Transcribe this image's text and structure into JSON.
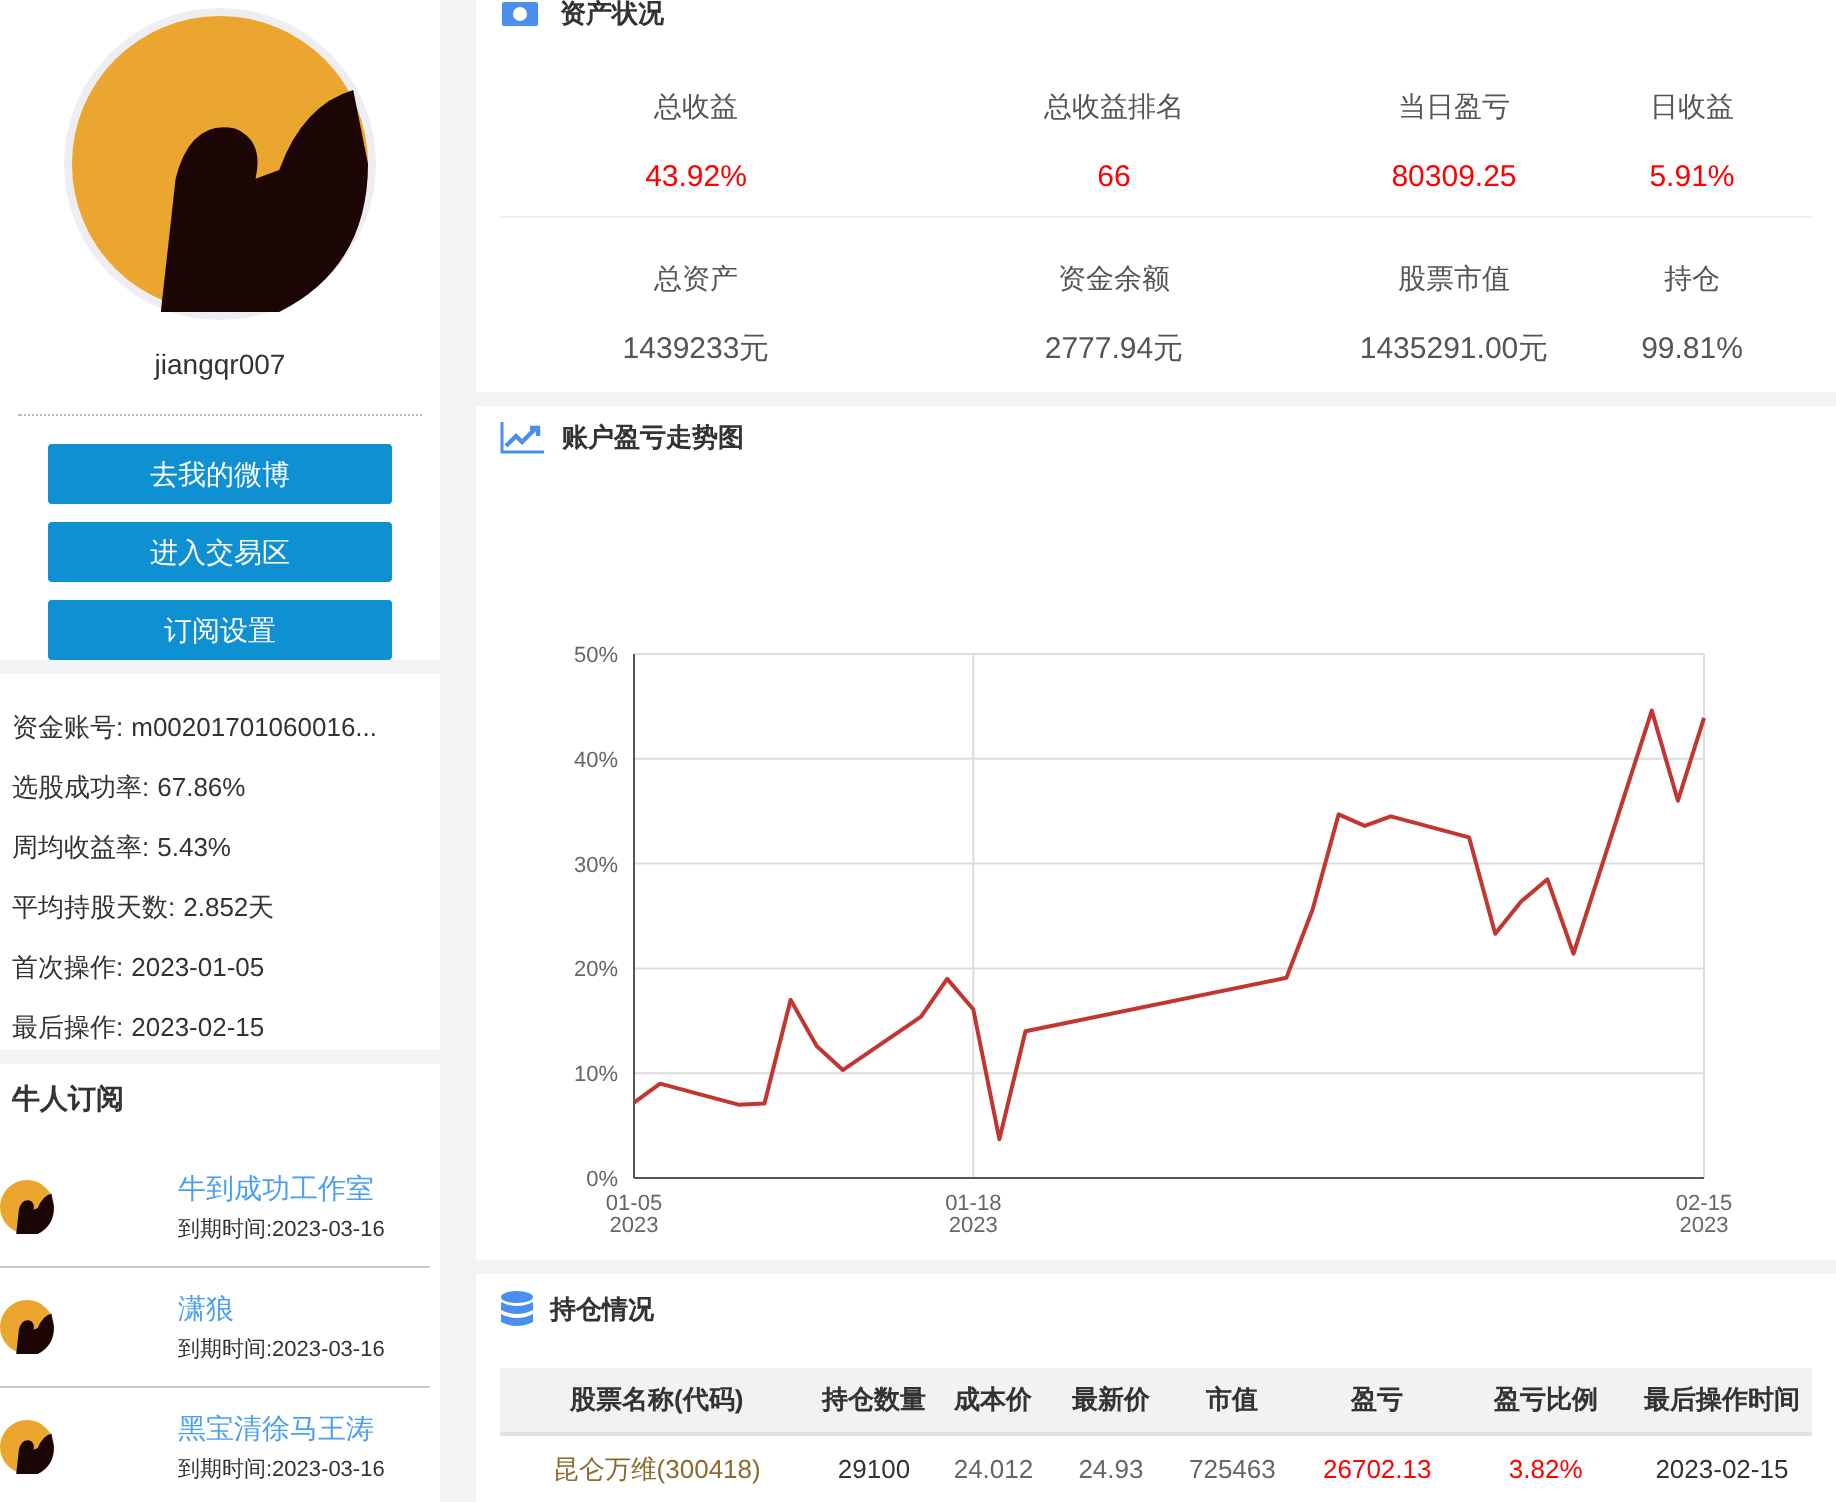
{
  "profile": {
    "username": "jiangqr007",
    "buttons": [
      "去我的微博",
      "进入交易区",
      "订阅设置"
    ]
  },
  "stats": [
    {
      "label": "资金账号:",
      "value": "m00201701060016..."
    },
    {
      "label": "选股成功率:",
      "value": "67.86%"
    },
    {
      "label": "周均收益率:",
      "value": "5.43%"
    },
    {
      "label": "平均持股天数:",
      "value": "2.852天"
    },
    {
      "label": "首次操作:",
      "value": "2023-01-05"
    },
    {
      "label": "最后操作:",
      "value": "2023-02-15"
    }
  ],
  "subscriptions": {
    "title": "牛人订阅",
    "items": [
      {
        "name": "牛到成功工作室",
        "expiry": "到期时间:2023-03-16"
      },
      {
        "name": "潇狼",
        "expiry": "到期时间:2023-03-16"
      },
      {
        "name": "黑宝清徐马王涛",
        "expiry": "到期时间:2023-03-16"
      }
    ]
  },
  "assets": {
    "title": "资产状况",
    "rows": [
      [
        {
          "label": "总收益",
          "value": "43.92%",
          "highlight": true
        },
        {
          "label": "总收益排名",
          "value": "66",
          "highlight": true
        },
        {
          "label": "当日盈亏",
          "value": "80309.25",
          "highlight": true
        },
        {
          "label": "日收益",
          "value": "5.91%",
          "highlight": true
        }
      ],
      [
        {
          "label": "总资产",
          "value": "1439233元",
          "highlight": false
        },
        {
          "label": "资金余额",
          "value": "2777.94元",
          "highlight": false
        },
        {
          "label": "股票市值",
          "value": "1435291.00元",
          "highlight": false
        },
        {
          "label": "持仓",
          "value": "99.81%",
          "highlight": false
        }
      ]
    ]
  },
  "trend": {
    "title": "账户盈亏走势图",
    "chart_data": {
      "type": "line",
      "categories": [
        "01-05 2023",
        null,
        null,
        null,
        null,
        null,
        null,
        null,
        null,
        null,
        null,
        null,
        null,
        "01-18 2023",
        null,
        null,
        null,
        null,
        null,
        null,
        null,
        null,
        null,
        null,
        null,
        null,
        null,
        null,
        null,
        null,
        null,
        null,
        null,
        null,
        null,
        null,
        null,
        null,
        null,
        null,
        null,
        "02-15 2023"
      ],
      "series": [
        {
          "color": "#c23531",
          "values": [
            7.2,
            9.0,
            null,
            null,
            7.0,
            7.1,
            17.0,
            12.6,
            10.3,
            null,
            null,
            15.4,
            19.0,
            16.1,
            3.7,
            14.0,
            null,
            null,
            null,
            null,
            null,
            null,
            null,
            null,
            null,
            19.1,
            25.6,
            34.7,
            33.6,
            34.5,
            null,
            null,
            32.5,
            23.3,
            26.4,
            28.5,
            21.4,
            null,
            null,
            44.6,
            36.0,
            43.9
          ]
        }
      ],
      "ylim": [
        0,
        50
      ],
      "grid": true,
      "yticks": [
        {
          "value": 0,
          "label": "0%"
        },
        {
          "value": 10,
          "label": "10%"
        },
        {
          "value": 20,
          "label": "20%"
        },
        {
          "value": 30,
          "label": "30%"
        },
        {
          "value": 40,
          "label": "40%"
        },
        {
          "value": 50,
          "label": "50%"
        }
      ]
    }
  },
  "holdings": {
    "title": "持仓情况",
    "columns": [
      "股票名称(代码)",
      "持仓数量",
      "成本价",
      "最新价",
      "市值",
      "盈亏",
      "盈亏比例",
      "最后操作时间"
    ],
    "rows": [
      [
        "昆仑万维(300418)",
        "29100",
        "24.012",
        "24.93",
        "725463",
        "26702.13",
        "3.82%",
        "2023-02-15"
      ]
    ]
  }
}
